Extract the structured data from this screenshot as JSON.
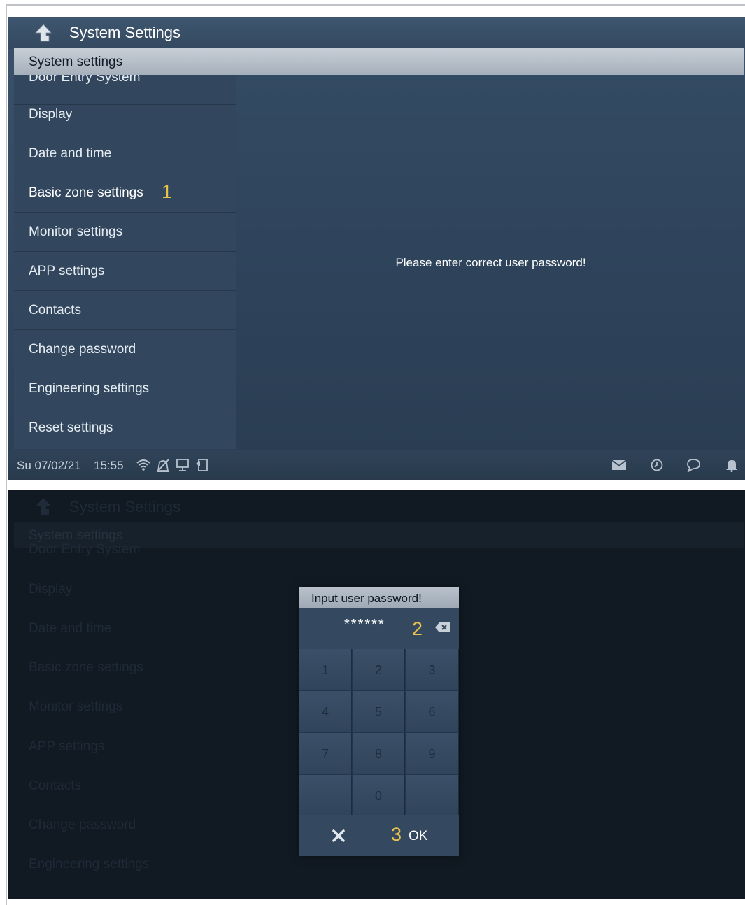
{
  "top_screen": {
    "title": "System Settings",
    "section_header": "System settings",
    "sidebar_items": [
      {
        "label": "Door Entry System"
      },
      {
        "label": "Display"
      },
      {
        "label": "Date and time"
      },
      {
        "label": "Basic zone settings",
        "step": "1"
      },
      {
        "label": "Monitor settings"
      },
      {
        "label": "APP settings"
      },
      {
        "label": "Contacts"
      },
      {
        "label": "Change password"
      },
      {
        "label": "Engineering settings"
      },
      {
        "label": "Reset settings"
      }
    ],
    "message": "Please enter correct user password!",
    "status": {
      "date": "Su 07/02/21",
      "time": "15:55",
      "left_icons": [
        "wifi-icon",
        "no-disturb-icon",
        "monitor-icon",
        "door-icon"
      ],
      "right_icons": [
        "mail-icon",
        "history-icon",
        "chat-icon",
        "bell-icon"
      ]
    }
  },
  "bottom_screen": {
    "title": "System Settings",
    "section_header": "System settings",
    "sidebar_items": [
      "Door Entry System",
      "Display",
      "Date and time",
      "Basic zone settings",
      "Monitor settings",
      "APP settings",
      "Contacts",
      "Change password",
      "Engineering settings"
    ],
    "dialog": {
      "title": "Input user password!",
      "password_value": "******",
      "password_step": "2",
      "keys": [
        "1",
        "2",
        "3",
        "4",
        "5",
        "6",
        "7",
        "8",
        "9",
        "",
        "0",
        ""
      ],
      "ok_label": "OK",
      "ok_step": "3"
    }
  },
  "colors": {
    "step_number": "#e9c24b",
    "panel": "#32475e",
    "header": "#b9c2cc"
  }
}
